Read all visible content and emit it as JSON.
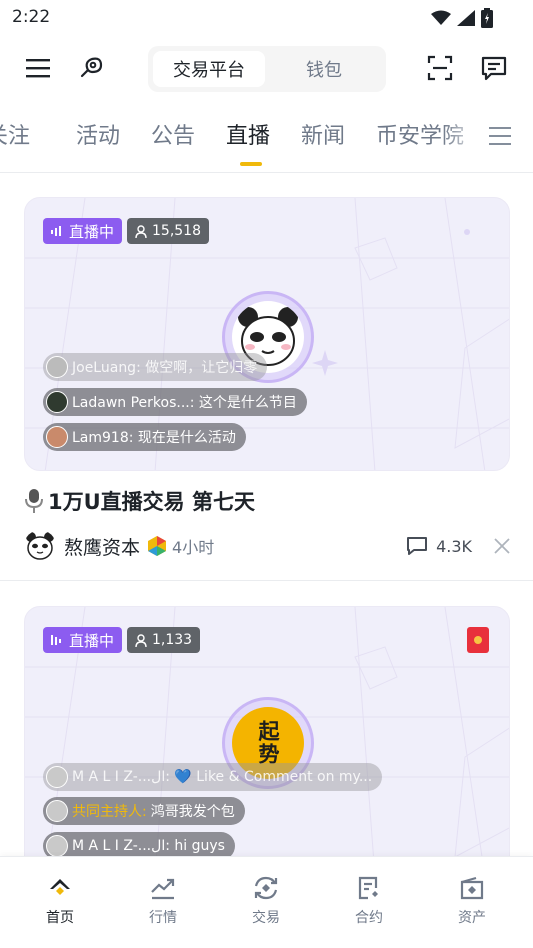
{
  "status_bar": {
    "time": "2:22"
  },
  "top_bar": {
    "segment": {
      "active": "交易平台",
      "inactive": "钱包"
    }
  },
  "tabs": [
    {
      "label": "关注",
      "active": false
    },
    {
      "label": "活动",
      "active": false
    },
    {
      "label": "公告",
      "active": false
    },
    {
      "label": "直播",
      "active": true
    },
    {
      "label": "新闻",
      "active": false
    },
    {
      "label": "币安学院",
      "active": false
    }
  ],
  "posts": [
    {
      "live_label": "直播中",
      "viewers": "15,518",
      "chats": [
        {
          "text": "JoeLuang: 做空啊，让它归零"
        },
        {
          "text": "Ladawn Perkos...: 这个是什么节目"
        },
        {
          "text": "Lam918: 现在是什么活动"
        }
      ],
      "title": "1万U直播交易 第七天",
      "author": "熬鹰资本",
      "time_ago": "4小时",
      "comments": "4.3K"
    },
    {
      "live_label": "直播中",
      "viewers": "1,133",
      "avatar_text": "起势",
      "chats": [
        {
          "text": "M A L I Z-...ال: 💙 Like & Comment on my..."
        },
        {
          "host": "共同主持人: ",
          "text": "鸿哥我发个包"
        },
        {
          "text": "M A L I Z-...ال: hi guys"
        }
      ]
    }
  ],
  "bottom_nav": [
    {
      "label": "首页",
      "icon": "home-icon",
      "active": true
    },
    {
      "label": "行情",
      "icon": "markets-icon",
      "active": false
    },
    {
      "label": "交易",
      "icon": "trade-icon",
      "active": false
    },
    {
      "label": "合约",
      "icon": "futures-icon",
      "active": false
    },
    {
      "label": "资产",
      "icon": "wallet-icon",
      "active": false
    }
  ],
  "colors": {
    "accent": "#f0b90b",
    "live": "#8c5cf0",
    "text": "#1e2329",
    "muted": "#707a8a"
  }
}
